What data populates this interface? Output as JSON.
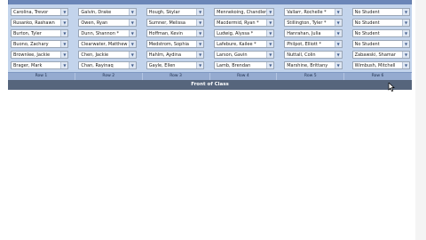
{
  "seats": [
    [
      "Carolina, Trevor",
      "Galvin, Drake",
      "Hough, Skylar",
      "Mennekoing, Chandler",
      "Vallarr, Rochelle *",
      "No Student"
    ],
    [
      "Rusanko, Rashawn",
      "Owen, Ryan",
      "Sumner, Melissa",
      "Macdermid, Ryan *",
      "Stillington, Tyler *",
      "No Student"
    ],
    [
      "Burton, Tyler",
      "Dunn, Shannon *",
      "Hoffman, Kevin",
      "Ludwig, Alyssa *",
      "Hanrahan, Julia",
      "No Student"
    ],
    [
      "Buono, Zachary",
      "Clearwater, Matthew",
      "Medstrom, Sophia",
      "Lafebure, Kailee *",
      "Philpot, Elliott *",
      "No Student"
    ],
    [
      "Brownlee, Jackie",
      "Chen, Jackie",
      "Hahlm, Aydina",
      "Larson, Gavin",
      "Nuttall, Colin",
      "Zabawski, Shamar"
    ],
    [
      "Brager, Mark",
      "Chan, Rayinaq",
      "Gayle, Ellen",
      "Lamb, Brendan",
      "Marshine, Brittany",
      "Wimbush, Mitchell"
    ]
  ],
  "row_labels": [
    "Row 1",
    "Row 2",
    "Row 3",
    "Row 4",
    "Row 5",
    "Row 6"
  ],
  "front_label": "Front of Class",
  "dropdown_icon": "chevron-down-icon",
  "cursor_icon": "mouse-pointer-icon"
}
